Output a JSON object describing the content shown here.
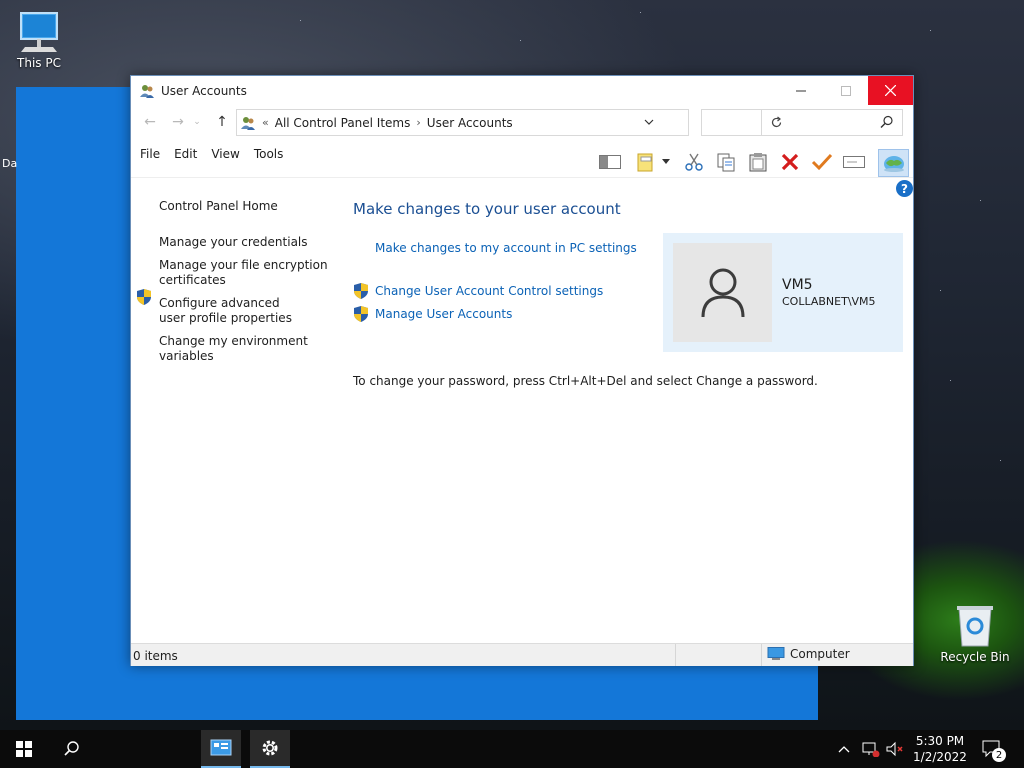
{
  "desktop": {
    "icons": [
      {
        "label": "This PC"
      },
      {
        "label": "Recycle Bin"
      }
    ],
    "edge_fragments": [
      "Da"
    ]
  },
  "window": {
    "title": "User Accounts",
    "breadcrumb": {
      "overflow": "«",
      "items": [
        "All Control Panel Items",
        "User Accounts"
      ]
    },
    "search_placeholder": "",
    "menu": [
      "File",
      "Edit",
      "View",
      "Tools"
    ],
    "left_pane": {
      "home": "Control Panel Home",
      "links": [
        {
          "label": "Manage your credentials",
          "shield": false
        },
        {
          "label": "Manage your file encryption certificates",
          "shield": false
        },
        {
          "label": "Configure advanced user profile properties",
          "shield": true
        },
        {
          "label": "Change my environment variables",
          "shield": false
        }
      ]
    },
    "main": {
      "heading": "Make changes to your user account",
      "pc_settings_link": "Make changes to my account in PC settings",
      "uac_link": "Change User Account Control settings",
      "manage_link": "Manage User Accounts",
      "password_note": "To change your password, press Ctrl+Alt+Del and select Change a password."
    },
    "user": {
      "name": "VM5",
      "domain": "COLLABNET\\VM5"
    },
    "status": {
      "items": "0 items",
      "zone": "Computer"
    },
    "help_label": "?"
  },
  "taskbar": {
    "time": "5:30 PM",
    "date": "1/2/2022",
    "notification_count": "2"
  },
  "colors": {
    "accent": "#1477d8",
    "link": "#0b62b6",
    "heading": "#1b4f93",
    "close": "#e81123"
  }
}
